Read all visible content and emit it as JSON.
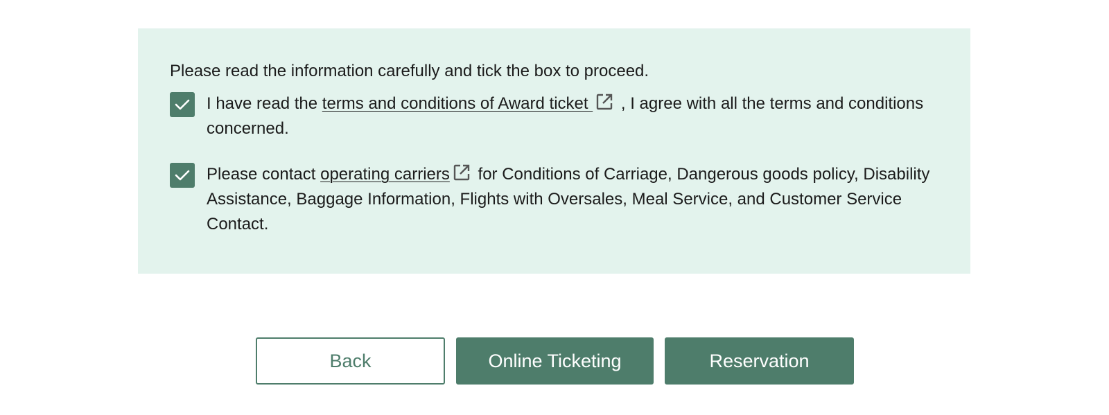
{
  "notice": {
    "intro": "Please read the information carefully and tick the box to proceed.",
    "item1": {
      "checked": true,
      "before": "I have read the ",
      "link": "terms and conditions of Award ticket ",
      "after": " , I agree with all the terms and conditions concerned."
    },
    "item2": {
      "checked": true,
      "before": "Please contact ",
      "link": "operating carriers",
      "after": "  for Conditions of Carriage, Dangerous goods policy, Disability Assistance, Baggage Information, Flights with Oversales, Meal Service, and Customer Service Contact."
    }
  },
  "buttons": {
    "back": "Back",
    "online_ticketing": "Online Ticketing",
    "reservation": "Reservation"
  },
  "icons": {
    "checkbox": "check-icon",
    "external_link": "external-link-icon"
  },
  "colors": {
    "accent": "#4e7d6b",
    "panel_background": "#e3f3ed",
    "text": "#1b1b1b"
  }
}
